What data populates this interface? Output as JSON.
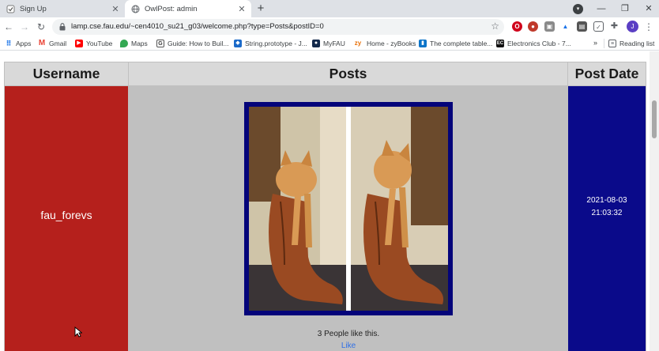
{
  "browser": {
    "tabs": [
      {
        "title": "Sign Up",
        "active": false
      },
      {
        "title": "OwlPost: admin",
        "active": true
      }
    ],
    "url": "lamp.cse.fau.edu/~cen4010_su21_g03/welcome.php?type=Posts&postID=0",
    "profile_initial": "J",
    "bookmarks": [
      {
        "label": "Apps",
        "icon": "apps-grid-icon"
      },
      {
        "label": "Gmail",
        "icon": "gmail-icon"
      },
      {
        "label": "YouTube",
        "icon": "youtube-icon"
      },
      {
        "label": "Maps",
        "icon": "maps-icon"
      },
      {
        "label": "Guide: How to Buil...",
        "icon": "guide-icon"
      },
      {
        "label": "String.prototype - J...",
        "icon": "mdn-icon"
      },
      {
        "label": "MyFAU",
        "icon": "myfau-icon"
      },
      {
        "label": "Home - zyBooks",
        "icon": "zybooks-icon"
      },
      {
        "label": "The complete table...",
        "icon": "bookmark-page-icon"
      },
      {
        "label": "Electronics Club - 7...",
        "icon": "electronics-club-icon"
      }
    ],
    "bookmarks_more": "»",
    "reading_list": "Reading list"
  },
  "table": {
    "headers": {
      "username": "Username",
      "posts": "Posts",
      "post_date": "Post Date"
    },
    "rows": [
      {
        "username": "fau_forevs",
        "post_image": "orange cat sitting inside a brown cowboy boot (two-frame collage)",
        "likes_text": "3 People like this.",
        "like_link": "Like",
        "post_date": "2021-08-03",
        "post_time": "21:03:32"
      }
    ]
  },
  "colors": {
    "username_cell": "#b5201c",
    "posts_cell": "#c0c0c0",
    "date_cell": "#0a0a8a",
    "header_bg": "#d9d9d9",
    "photo_frame": "#04047a",
    "like_link": "#2f6fe6"
  }
}
